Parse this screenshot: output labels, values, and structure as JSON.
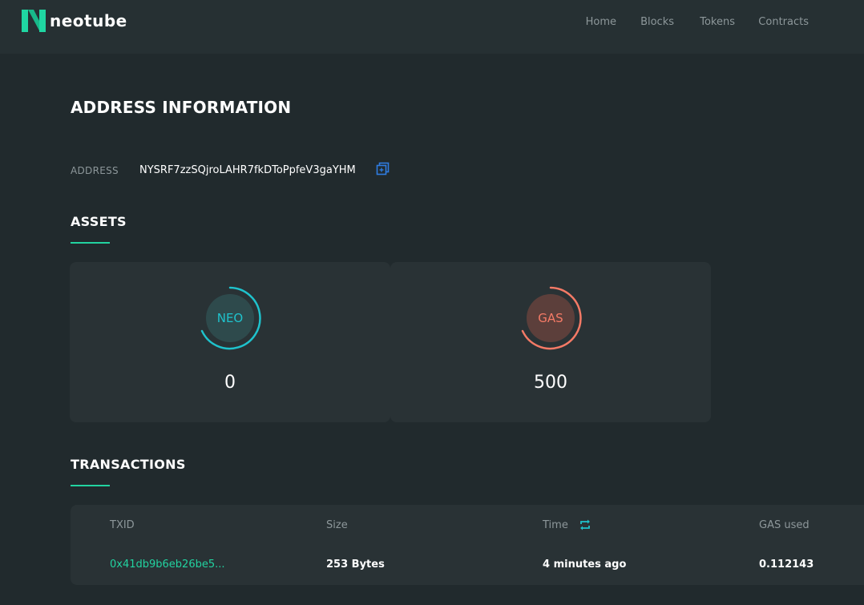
{
  "header": {
    "logo_text": "neotube",
    "nav": [
      {
        "label": "Home"
      },
      {
        "label": "Blocks"
      },
      {
        "label": "Tokens"
      },
      {
        "label": "Contracts"
      }
    ]
  },
  "page": {
    "title": "ADDRESS INFORMATION",
    "address_label": "ADDRESS",
    "address_value": "NYSRF7zzSQjroLAHR7fkDToPpfeV3gaYHM"
  },
  "assets": {
    "title": "ASSETS",
    "items": [
      {
        "name": "NEO",
        "amount": "0",
        "color": "#1fc2cc",
        "bg": "#2e4a4c"
      },
      {
        "name": "GAS",
        "amount": "500",
        "color": "#f47a66",
        "bg": "#5c3f3b"
      }
    ]
  },
  "transactions": {
    "title": "TRANSACTIONS",
    "headers": {
      "txid": "TXID",
      "size": "Size",
      "time": "Time",
      "gas": "GAS used"
    },
    "rows": [
      {
        "txid": "0x41db9b6eb26be5...",
        "size": "253 Bytes",
        "time": "4 minutes ago",
        "gas": "0.112143"
      }
    ]
  },
  "colors": {
    "accent": "#22d3a0",
    "background": "#212a2d",
    "header": "#263033",
    "card": "#293235",
    "muted_text": "#8d979a",
    "copy_icon": "#2f7de1"
  }
}
